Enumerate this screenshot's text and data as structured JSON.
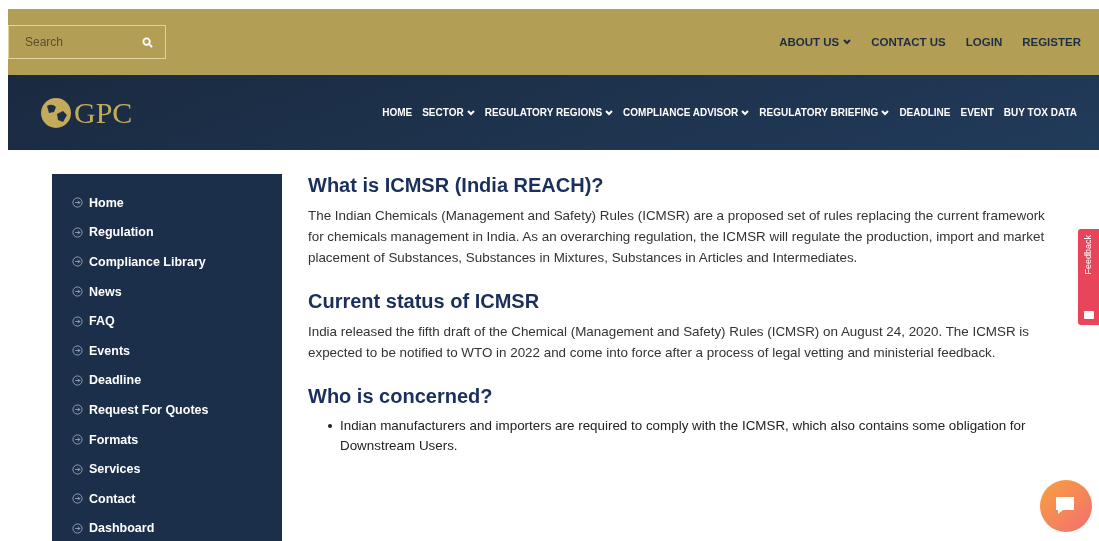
{
  "topbar": {
    "search": {
      "placeholder": "Search"
    },
    "links": [
      {
        "label": "ABOUT US",
        "dropdown": true
      },
      {
        "label": "CONTACT US",
        "dropdown": false
      },
      {
        "label": "LOGIN",
        "dropdown": false
      },
      {
        "label": "REGISTER",
        "dropdown": false
      }
    ]
  },
  "header": {
    "logo": "GPC",
    "nav": [
      {
        "label": "HOME",
        "dropdown": false
      },
      {
        "label": "SECTOR",
        "dropdown": true
      },
      {
        "label": "REGULATORY REGIONS",
        "dropdown": true
      },
      {
        "label": "COMPLIANCE ADVISOR",
        "dropdown": true
      },
      {
        "label": "REGULATORY BRIEFING",
        "dropdown": true
      },
      {
        "label": "DEADLINE",
        "dropdown": false
      },
      {
        "label": "EVENT",
        "dropdown": false
      },
      {
        "label": "BUY TOX DATA",
        "dropdown": false
      }
    ]
  },
  "sidebar": {
    "items": [
      "Home",
      "Regulation",
      "Compliance Library",
      "News",
      "FAQ",
      "Events",
      "Deadline",
      "Request For Quotes",
      "Formats",
      "Services",
      "Contact",
      "Dashboard"
    ]
  },
  "content": [
    {
      "kind": "heading",
      "text": "What is ICMSR (India REACH)?"
    },
    {
      "kind": "paragraph",
      "text": "The Indian Chemicals (Management and Safety) Rules (ICMSR) are a proposed set of rules replacing the current framework for chemicals management in India. As an overarching regulation, the ICMSR will regulate the production, import and market placement of Substances, Substances in Mixtures, Substances in Articles and Intermediates."
    },
    {
      "kind": "heading",
      "text": "Current status of ICMSR"
    },
    {
      "kind": "paragraph",
      "text": "India released the fifth draft of the Chemical (Management and Safety) Rules (ICMSR) on August 24, 2020. The ICMSR is expected to be notified to WTO in 2022 and come into force after a process of legal vetting and ministerial feedback."
    },
    {
      "kind": "heading",
      "text": "Who is concerned?"
    },
    {
      "kind": "bullet",
      "text": "Indian manufacturers and importers are required to comply with the ICMSR, which also contains some obligation for Downstream Users."
    }
  ],
  "feedback": {
    "label": "Feedback"
  }
}
